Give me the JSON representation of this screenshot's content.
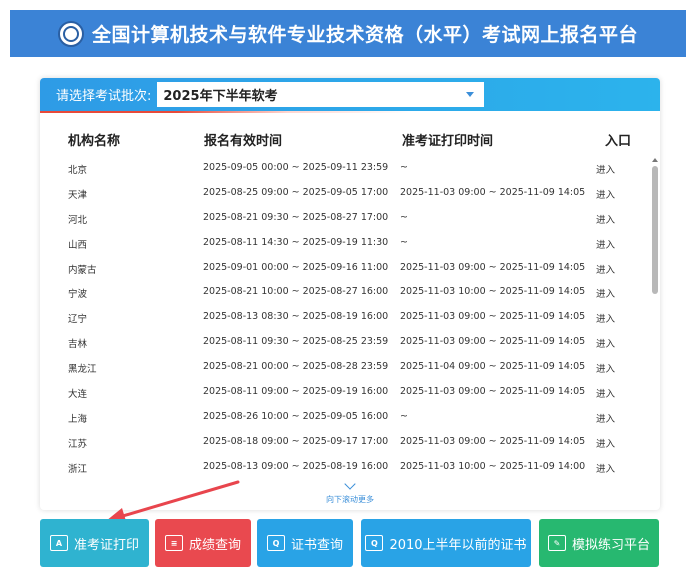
{
  "header": {
    "title": "全国计算机技术与软件专业技术资格（水平）考试网上报名平台"
  },
  "batch": {
    "label": "请选择考试批次:",
    "value": "2025年下半年软考"
  },
  "table": {
    "headers": [
      "机构名称",
      "报名有效时间",
      "准考证打印时间",
      "入口"
    ],
    "rows": [
      {
        "name": "北京",
        "reg": "2025-09-05 00:00 ~ 2025-09-11 23:59",
        "print": "~",
        "entry": "进入"
      },
      {
        "name": "天津",
        "reg": "2025-08-25 09:00 ~ 2025-09-05 17:00",
        "print": "2025-11-03 09:00 ~ 2025-11-09 14:05",
        "entry": "进入"
      },
      {
        "name": "河北",
        "reg": "2025-08-21 09:30 ~ 2025-08-27 17:00",
        "print": "~",
        "entry": "进入"
      },
      {
        "name": "山西",
        "reg": "2025-08-11 14:30 ~ 2025-09-19 11:30",
        "print": "~",
        "entry": "进入"
      },
      {
        "name": "内蒙古",
        "reg": "2025-09-01 00:00 ~ 2025-09-16 11:00",
        "print": "2025-11-03 09:00 ~ 2025-11-09 14:05",
        "entry": "进入"
      },
      {
        "name": "宁波",
        "reg": "2025-08-21 10:00 ~ 2025-08-27 16:00",
        "print": "2025-11-03 10:00 ~ 2025-11-09 14:05",
        "entry": "进入"
      },
      {
        "name": "辽宁",
        "reg": "2025-08-13 08:30 ~ 2025-08-19 16:00",
        "print": "2025-11-03 09:00 ~ 2025-11-09 14:05",
        "entry": "进入"
      },
      {
        "name": "吉林",
        "reg": "2025-08-11 09:30 ~ 2025-08-25 23:59",
        "print": "2025-11-03 09:00 ~ 2025-11-09 14:05",
        "entry": "进入"
      },
      {
        "name": "黑龙江",
        "reg": "2025-08-21 00:00 ~ 2025-08-28 23:59",
        "print": "2025-11-04 09:00 ~ 2025-11-09 14:05",
        "entry": "进入"
      },
      {
        "name": "大连",
        "reg": "2025-08-11 09:00 ~ 2025-09-19 16:00",
        "print": "2025-11-03 09:00 ~ 2025-11-09 14:05",
        "entry": "进入"
      },
      {
        "name": "上海",
        "reg": "2025-08-26 10:00 ~ 2025-09-05 16:00",
        "print": "~",
        "entry": "进入"
      },
      {
        "name": "江苏",
        "reg": "2025-08-18 09:00 ~ 2025-09-17 17:00",
        "print": "2025-11-03 09:00 ~ 2025-11-09 14:05",
        "entry": "进入"
      },
      {
        "name": "浙江",
        "reg": "2025-08-13 09:00 ~ 2025-08-19 16:00",
        "print": "2025-11-03 10:00 ~ 2025-11-09 14:00",
        "entry": "进入"
      }
    ]
  },
  "more": {
    "text": "向下滚动更多"
  },
  "buttons": {
    "admission": "准考证打印",
    "scores": "成绩查询",
    "certificate": "证书查询",
    "old_certificate": "2010上半年以前的证书",
    "practice": "模拟练习平台"
  },
  "icons": {
    "admission": "ticket-icon",
    "scores": "document-list-icon",
    "certificate": "certificate-search-icon",
    "old_certificate": "certificate-search-icon",
    "practice": "edit-pen-icon"
  },
  "colors": {
    "header": "#3b83d6",
    "admission": "#2fb3d0",
    "scores": "#e9494f",
    "certificate": "#29a3e6",
    "practice": "#27b870",
    "annotation_arrow": "#e8454d"
  }
}
